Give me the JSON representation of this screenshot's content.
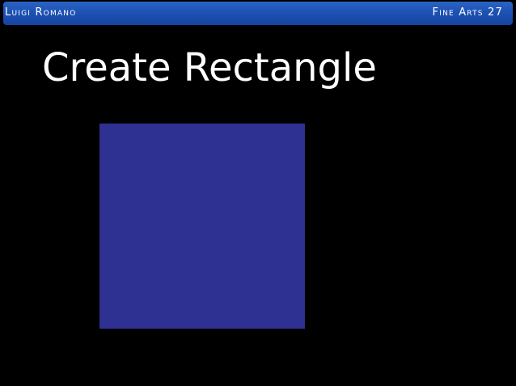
{
  "header": {
    "left_text": "Luigi Romano",
    "right_text": "Fine Arts 27"
  },
  "slide": {
    "title": "Create Rectangle",
    "rectangle": {
      "fill_color": "#2e3192"
    }
  },
  "colors": {
    "background": "#000000",
    "header_bar": "#1f55b8",
    "text": "#ffffff"
  }
}
